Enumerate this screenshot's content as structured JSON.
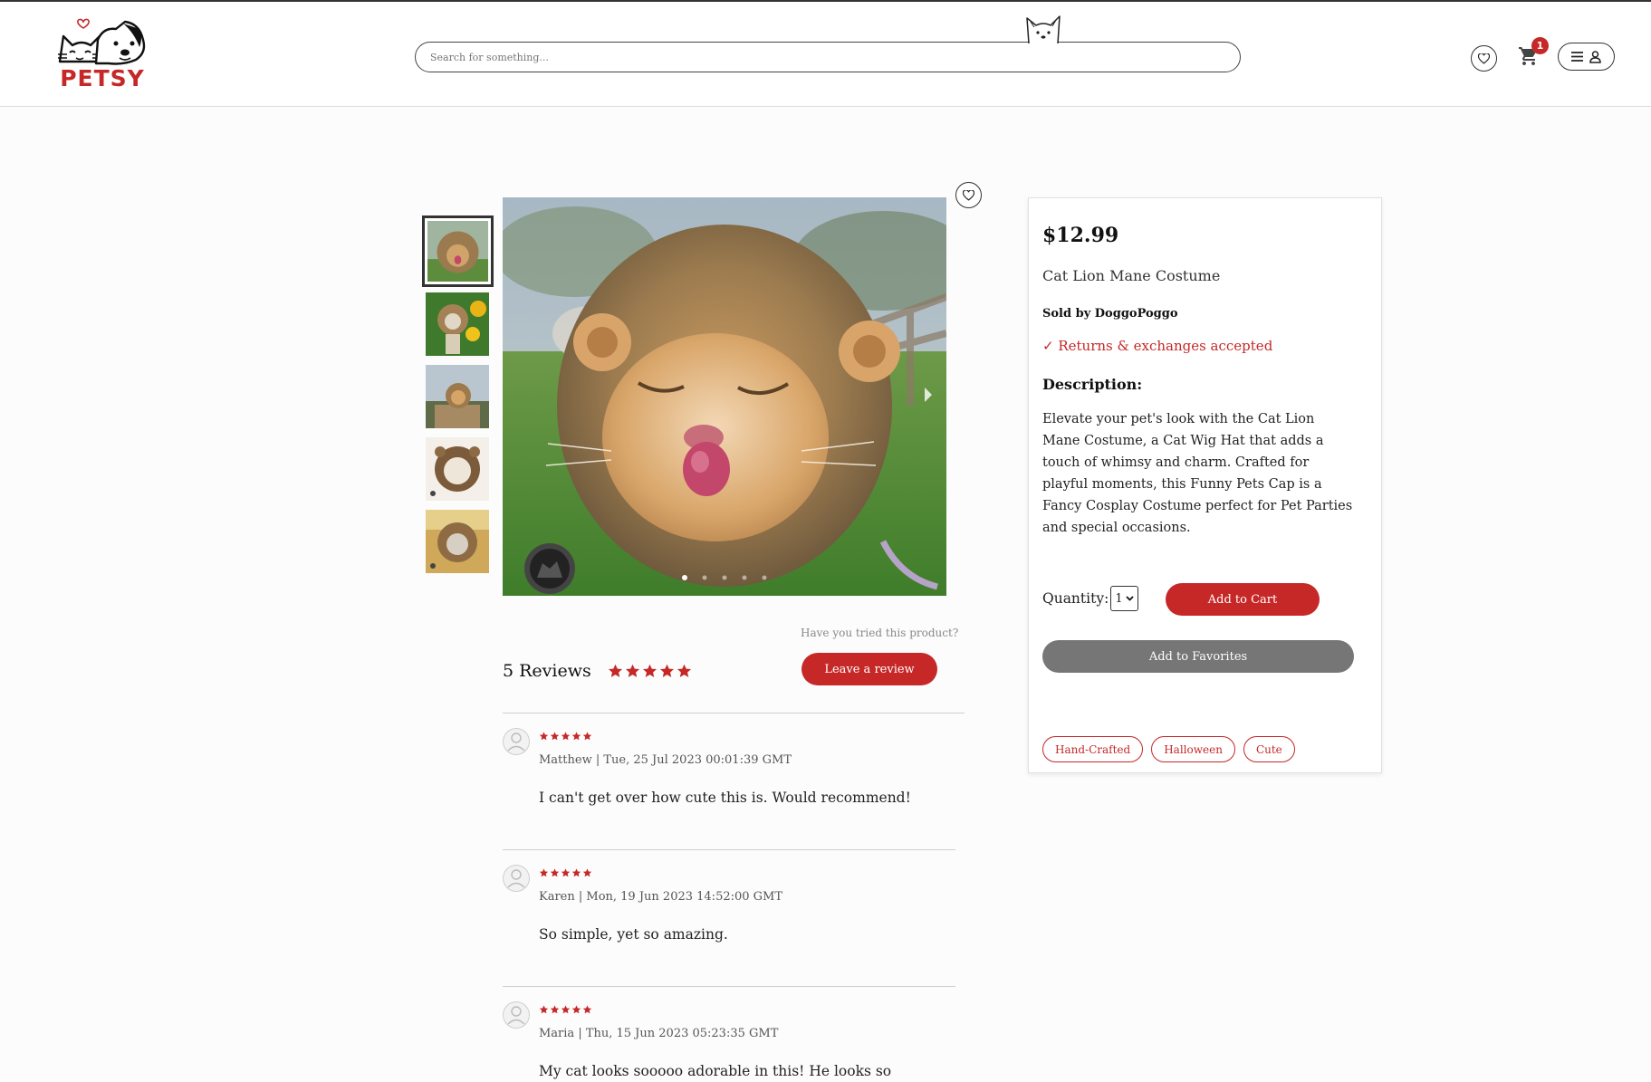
{
  "header": {
    "brand": "PETSY",
    "search_placeholder": "Search for something...",
    "cart_count": "1",
    "icons": [
      "heart-icon",
      "cart-icon",
      "menu-icon",
      "user-icon"
    ]
  },
  "gallery": {
    "thumbnail_count": 5,
    "active_index": 0,
    "dots": 5
  },
  "product": {
    "price": "$12.99",
    "name": "Cat Lion Mane Costume",
    "seller": "Sold by DoggoPoggo",
    "returns": "✓ Returns & exchanges accepted",
    "description_heading": "Description:",
    "description": "Elevate your pet's look with the Cat Lion Mane Costume, a Cat Wig Hat that adds a touch of whimsy and charm. Crafted for playful moments, this Funny Pets Cap is a Fancy Cosplay Costume perfect for Pet Parties and special occasions.",
    "quantity_label": "Quantity:",
    "quantity_value": "1",
    "add_to_cart": "Add to Cart",
    "add_to_favorites": "Add to Favorites",
    "tags": [
      "Hand-Crafted",
      "Halloween",
      "Cute"
    ]
  },
  "reviews": {
    "prompt": "Have you tried this product?",
    "count_label": "5 Reviews",
    "rating": 5,
    "leave_review": "Leave a review",
    "items": [
      {
        "author_date": "Matthew | Tue, 25 Jul 2023 00:01:39 GMT",
        "text": "I can't get over how cute this is. Would recommend!",
        "rating": 5
      },
      {
        "author_date": "Karen | Mon, 19 Jun 2023 14:52:00 GMT",
        "text": "So simple, yet so amazing.",
        "rating": 5
      },
      {
        "author_date": "Maria | Thu, 15 Jun 2023 05:23:35 GMT",
        "text": "My cat looks sooooo adorable in this! He looks so",
        "rating": 5
      }
    ]
  },
  "colors": {
    "accent": "#c62828",
    "secondary_button": "#767676",
    "text": "#222222"
  }
}
